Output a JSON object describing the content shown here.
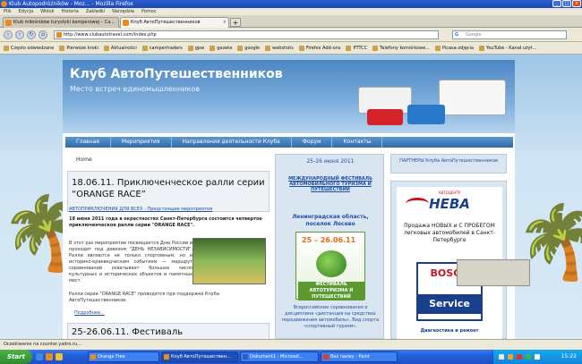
{
  "window": {
    "title": "Klub Autopodróżników - Moz... - Mozilla Firefox"
  },
  "menubar": [
    "Plik",
    "Edycja",
    "Widok",
    "Historia",
    "Zakładki",
    "Narzędzia",
    "Pomoc"
  ],
  "tabs": [
    {
      "label": "Klub miłośników turystyki kamperowej – Ca..."
    },
    {
      "label": "Клуб АвтоПутешественников"
    }
  ],
  "address": {
    "url": "http://www.clubautotravel.com/index.php"
  },
  "search": {
    "placeholder": "Google"
  },
  "bookmarks": [
    "Często odwiedzane",
    "Pierwsze kroki",
    "Aktualności",
    "campertraders",
    "gpw",
    "gazeta",
    "google",
    "webshots",
    "Firefox Add-ons",
    "PTTCC",
    "Telefony komórkowe...",
    "Picasa-zdjęcia",
    "YouTube - Kanał użyt..."
  ],
  "site": {
    "title": "Клуб АвтоПутешественников",
    "subtitle": "Место встреч единомышленников",
    "menu": [
      "Главная",
      "Мероприятия",
      "Направления деятельности Клуба",
      "Форум",
      "Контакты"
    ]
  },
  "main": {
    "breadcrumb": "Home",
    "post_title": "18.06.11. Приключенческое ралли серии “ORANGE RACE”",
    "categories": "АВТОПРИКЛЮЧЕНИЯ ДЛЯ ВСЕХ - Предстоящие мероприятия",
    "lead": "18 июня 2011 года в окрестностях Санкт-Петербурга состоится четвертое приключенческое ралли серии \"ORANGE RACE\".",
    "body1": "В этот раз мероприятие посвящается Дню России и проходит под девизом \"ДЕНЬ НЕЗАВИСИМОСТИ\". Ралли являются не только спортивным, но и историко-краеведческим событием — маршрут соревнований охватывает большое число культурных и исторических объектов и памятных мест.",
    "body2": "Ралли серии \"ORANGE RACE\" проводятся при поддержке Клуба АвтоПутешественников.",
    "more": "Подробнее...",
    "post2_title": "25-26.06.11. Фестиваль"
  },
  "middle": {
    "date": "25-26 июня 2011",
    "festival": "МЕЖДУНАРОДНЫЙ ФЕСТИВАЛЬ АВТОМОБИЛЬНОГО ТУРИЗМА И ПУТЕШЕСТВИЙ",
    "location": "Ленинградская область, поселок Лосево",
    "poster_date": "25 – 26.06.11",
    "poster_text": "ФЕСТИВАЛЬ АВТОТУРИЗМА И ПУТЕШЕСТВИЙ",
    "description": "Всероссийские соревнования в дисциплине «дистанция на средствах передвижения автомобиль». Вид спорта «спортивный туризм»."
  },
  "right": {
    "partners": "ПАРТНЕРЫ Клуба АвтоПутешественников",
    "ad_top": "АВТОЦЕНТР",
    "ad_brand": "НЕВА",
    "ad_text": "Продажа НОВЫХ и С ПРОБЕГОМ легковых автомобилей в Санкт-Петербурге",
    "bosch_top": "BOSCH",
    "bosch_bottom": "Service",
    "ad_footer": "Диагностика и ремонт"
  },
  "status": {
    "text": "Oczekiwanie na counter.yadro.ru..."
  },
  "taskbar": {
    "start": "Start",
    "tasks": [
      "Orange Free",
      "Клуб АвтоПутешествен...",
      "Dokument1 - Microsof...",
      "Bez nazwy - Paint"
    ],
    "clock": "15:22"
  },
  "colors": {
    "accent": "#2f6aa8",
    "link": "#1f4ea6",
    "xp_blue": "#245edb"
  }
}
